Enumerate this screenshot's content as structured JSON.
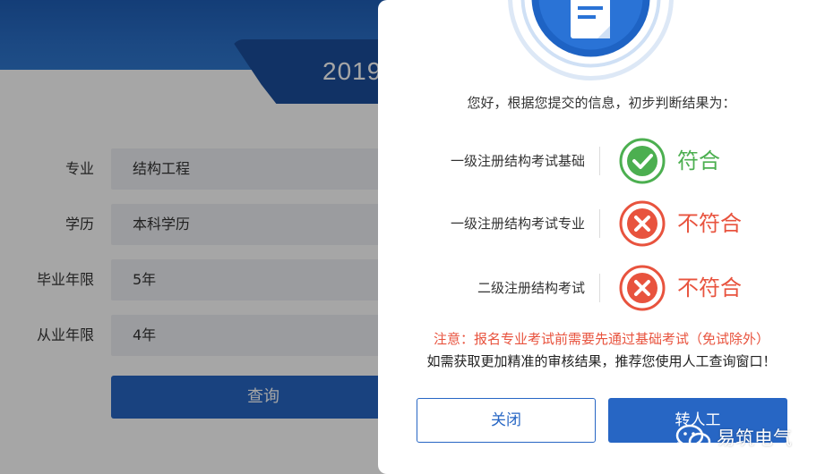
{
  "page": {
    "year_title": "2019",
    "form": [
      {
        "label": "专业",
        "value": "结构工程"
      },
      {
        "label": "学历",
        "value": "本科学历"
      },
      {
        "label": "毕业年限",
        "value": "5年"
      },
      {
        "label": "从业年限",
        "value": "4年"
      }
    ],
    "query_button": "查询"
  },
  "modal": {
    "greeting": "您好，根据您提交的信息，初步判断结果为：",
    "results": [
      {
        "name": "一级注册结构考试基础",
        "status": "pass",
        "status_text": "符合",
        "color": "#4caf50"
      },
      {
        "name": "一级注册结构考试专业",
        "status": "fail",
        "status_text": "不符合",
        "color": "#e8533e"
      },
      {
        "name": "二级注册结构考试",
        "status": "fail",
        "status_text": "不符合",
        "color": "#e8533e"
      }
    ],
    "note_red": "注意：报名专业考试前需要先通过基础考试（免试除外）",
    "note_black": "如需获取更加精准的审核结果，推荐您使用人工查询窗口！",
    "close_button": "关闭",
    "manual_button": "转人工"
  },
  "watermark": {
    "text": "易筑电气"
  },
  "colors": {
    "primary": "#2766c4",
    "pass": "#4caf50",
    "fail": "#e8533e"
  }
}
